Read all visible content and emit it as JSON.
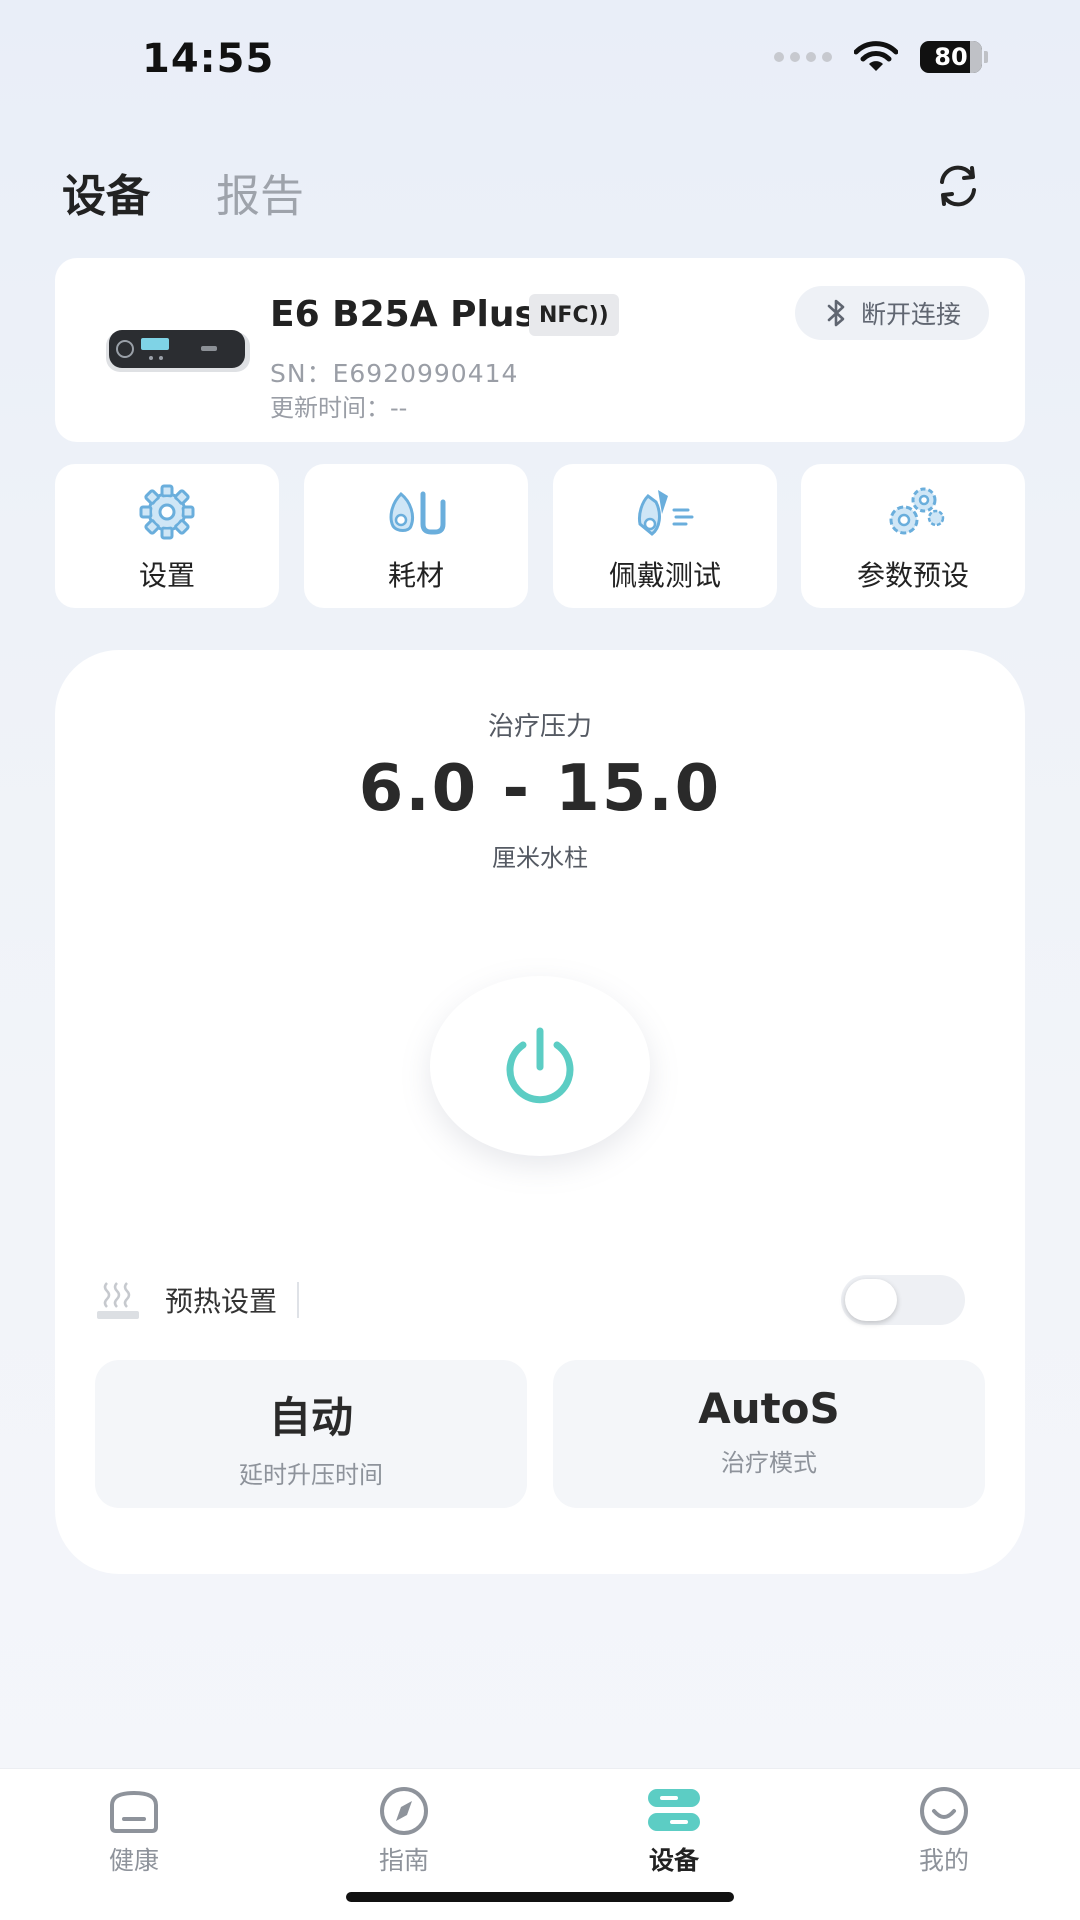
{
  "status_bar": {
    "time": "14:55",
    "battery": "80"
  },
  "header": {
    "tabs": [
      {
        "label": "设备",
        "active": true
      },
      {
        "label": "报告",
        "active": false
      }
    ],
    "refresh_icon": "refresh-icon"
  },
  "device": {
    "name": "E6 B25A Plus",
    "nfc_badge": "NFC))",
    "sn": "SN：E6920990414",
    "updated": "更新时间：--",
    "disconnect_label": "断开连接",
    "disconnect_icon": "bluetooth-icon"
  },
  "quick_actions": [
    {
      "label": "设置",
      "icon": "gear-icon"
    },
    {
      "label": "耗材",
      "icon": "mask-tube-icon"
    },
    {
      "label": "佩戴测试",
      "icon": "mask-test-icon"
    },
    {
      "label": "参数预设",
      "icon": "gears-icon"
    }
  ],
  "therapy": {
    "pressure_label": "治疗压力",
    "pressure_value": "6.0 - 15.0",
    "pressure_unit": "厘米水柱",
    "power_icon": "power-icon",
    "preheat_label": "预热设置",
    "preheat_enabled": false,
    "delay_value": "自动",
    "delay_label": "延时升压时间",
    "mode_value": "AutoS",
    "mode_label": "治疗模式"
  },
  "bottom_nav": [
    {
      "label": "健康",
      "icon": "health-icon",
      "active": false
    },
    {
      "label": "指南",
      "icon": "compass-icon",
      "active": false
    },
    {
      "label": "设备",
      "icon": "device-icon",
      "active": true
    },
    {
      "label": "我的",
      "icon": "smile-icon",
      "active": false
    }
  ],
  "colors": {
    "accent": "#5ccdc4",
    "icon_blue": "#6aaedc",
    "text_primary": "#222222",
    "text_secondary": "#9a9ea6"
  }
}
